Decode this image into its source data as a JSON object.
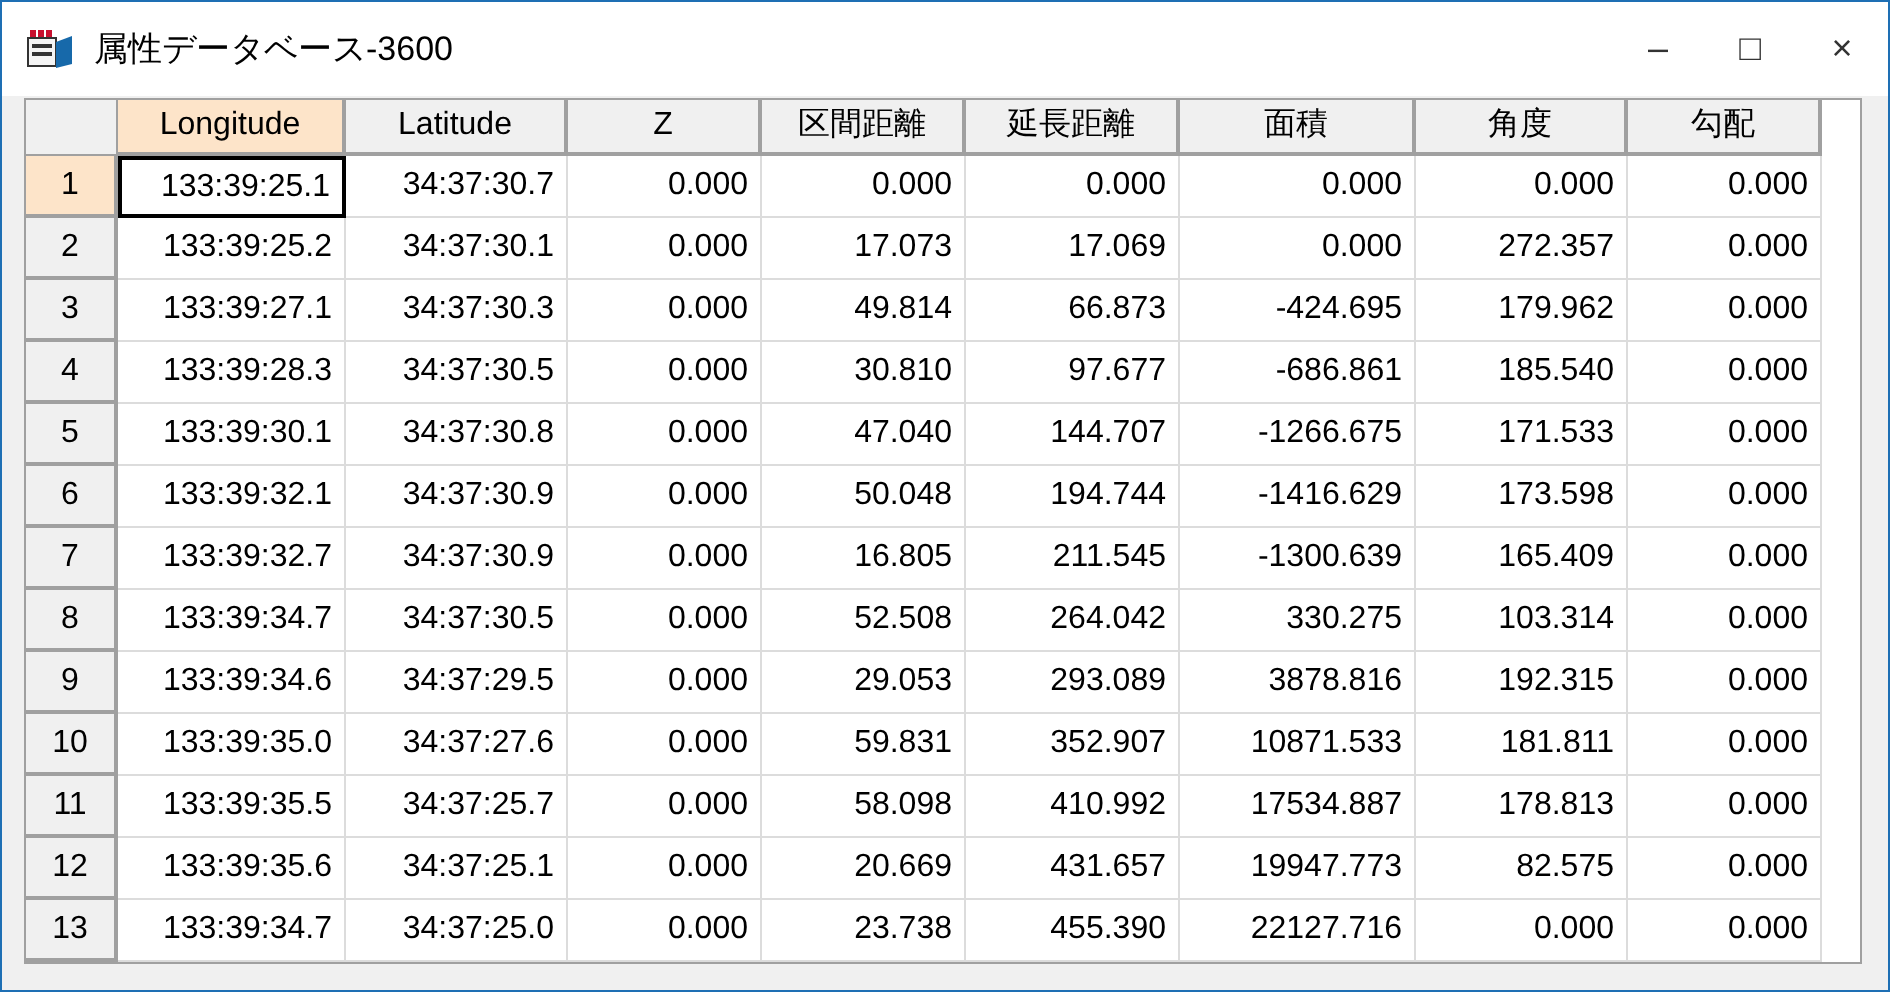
{
  "window": {
    "title": "属性データベース-3600",
    "controls": [
      "–",
      "□",
      "×"
    ]
  },
  "table": {
    "columns": [
      {
        "label": "Longitude",
        "selected": true
      },
      {
        "label": "Latitude",
        "selected": false
      },
      {
        "label": "Z",
        "selected": false
      },
      {
        "label": "区間距離",
        "selected": false
      },
      {
        "label": "延長距離",
        "selected": false
      },
      {
        "label": "面積",
        "selected": false
      },
      {
        "label": "角度",
        "selected": false
      },
      {
        "label": "勾配",
        "selected": false
      }
    ],
    "rows": [
      {
        "number": "1",
        "selected": true,
        "cells": [
          "133:39:25.1",
          "34:37:30.7",
          "0.000",
          "0.000",
          "0.000",
          "0.000",
          "0.000",
          "0.000"
        ]
      },
      {
        "number": "2",
        "selected": false,
        "cells": [
          "133:39:25.2",
          "34:37:30.1",
          "0.000",
          "17.073",
          "17.069",
          "0.000",
          "272.357",
          "0.000"
        ]
      },
      {
        "number": "3",
        "selected": false,
        "cells": [
          "133:39:27.1",
          "34:37:30.3",
          "0.000",
          "49.814",
          "66.873",
          "-424.695",
          "179.962",
          "0.000"
        ]
      },
      {
        "number": "4",
        "selected": false,
        "cells": [
          "133:39:28.3",
          "34:37:30.5",
          "0.000",
          "30.810",
          "97.677",
          "-686.861",
          "185.540",
          "0.000"
        ]
      },
      {
        "number": "5",
        "selected": false,
        "cells": [
          "133:39:30.1",
          "34:37:30.8",
          "0.000",
          "47.040",
          "144.707",
          "-1266.675",
          "171.533",
          "0.000"
        ]
      },
      {
        "number": "6",
        "selected": false,
        "cells": [
          "133:39:32.1",
          "34:37:30.9",
          "0.000",
          "50.048",
          "194.744",
          "-1416.629",
          "173.598",
          "0.000"
        ]
      },
      {
        "number": "7",
        "selected": false,
        "cells": [
          "133:39:32.7",
          "34:37:30.9",
          "0.000",
          "16.805",
          "211.545",
          "-1300.639",
          "165.409",
          "0.000"
        ]
      },
      {
        "number": "8",
        "selected": false,
        "cells": [
          "133:39:34.7",
          "34:37:30.5",
          "0.000",
          "52.508",
          "264.042",
          "330.275",
          "103.314",
          "0.000"
        ]
      },
      {
        "number": "9",
        "selected": false,
        "cells": [
          "133:39:34.6",
          "34:37:29.5",
          "0.000",
          "29.053",
          "293.089",
          "3878.816",
          "192.315",
          "0.000"
        ]
      },
      {
        "number": "10",
        "selected": false,
        "cells": [
          "133:39:35.0",
          "34:37:27.6",
          "0.000",
          "59.831",
          "352.907",
          "10871.533",
          "181.811",
          "0.000"
        ]
      },
      {
        "number": "11",
        "selected": false,
        "cells": [
          "133:39:35.5",
          "34:37:25.7",
          "0.000",
          "58.098",
          "410.992",
          "17534.887",
          "178.813",
          "0.000"
        ]
      },
      {
        "number": "12",
        "selected": false,
        "cells": [
          "133:39:35.6",
          "34:37:25.1",
          "0.000",
          "20.669",
          "431.657",
          "19947.773",
          "82.575",
          "0.000"
        ]
      },
      {
        "number": "13",
        "selected": false,
        "cells": [
          "133:39:34.7",
          "34:37:25.0",
          "0.000",
          "23.738",
          "455.390",
          "22127.716",
          "0.000",
          "0.000"
        ]
      }
    ]
  }
}
